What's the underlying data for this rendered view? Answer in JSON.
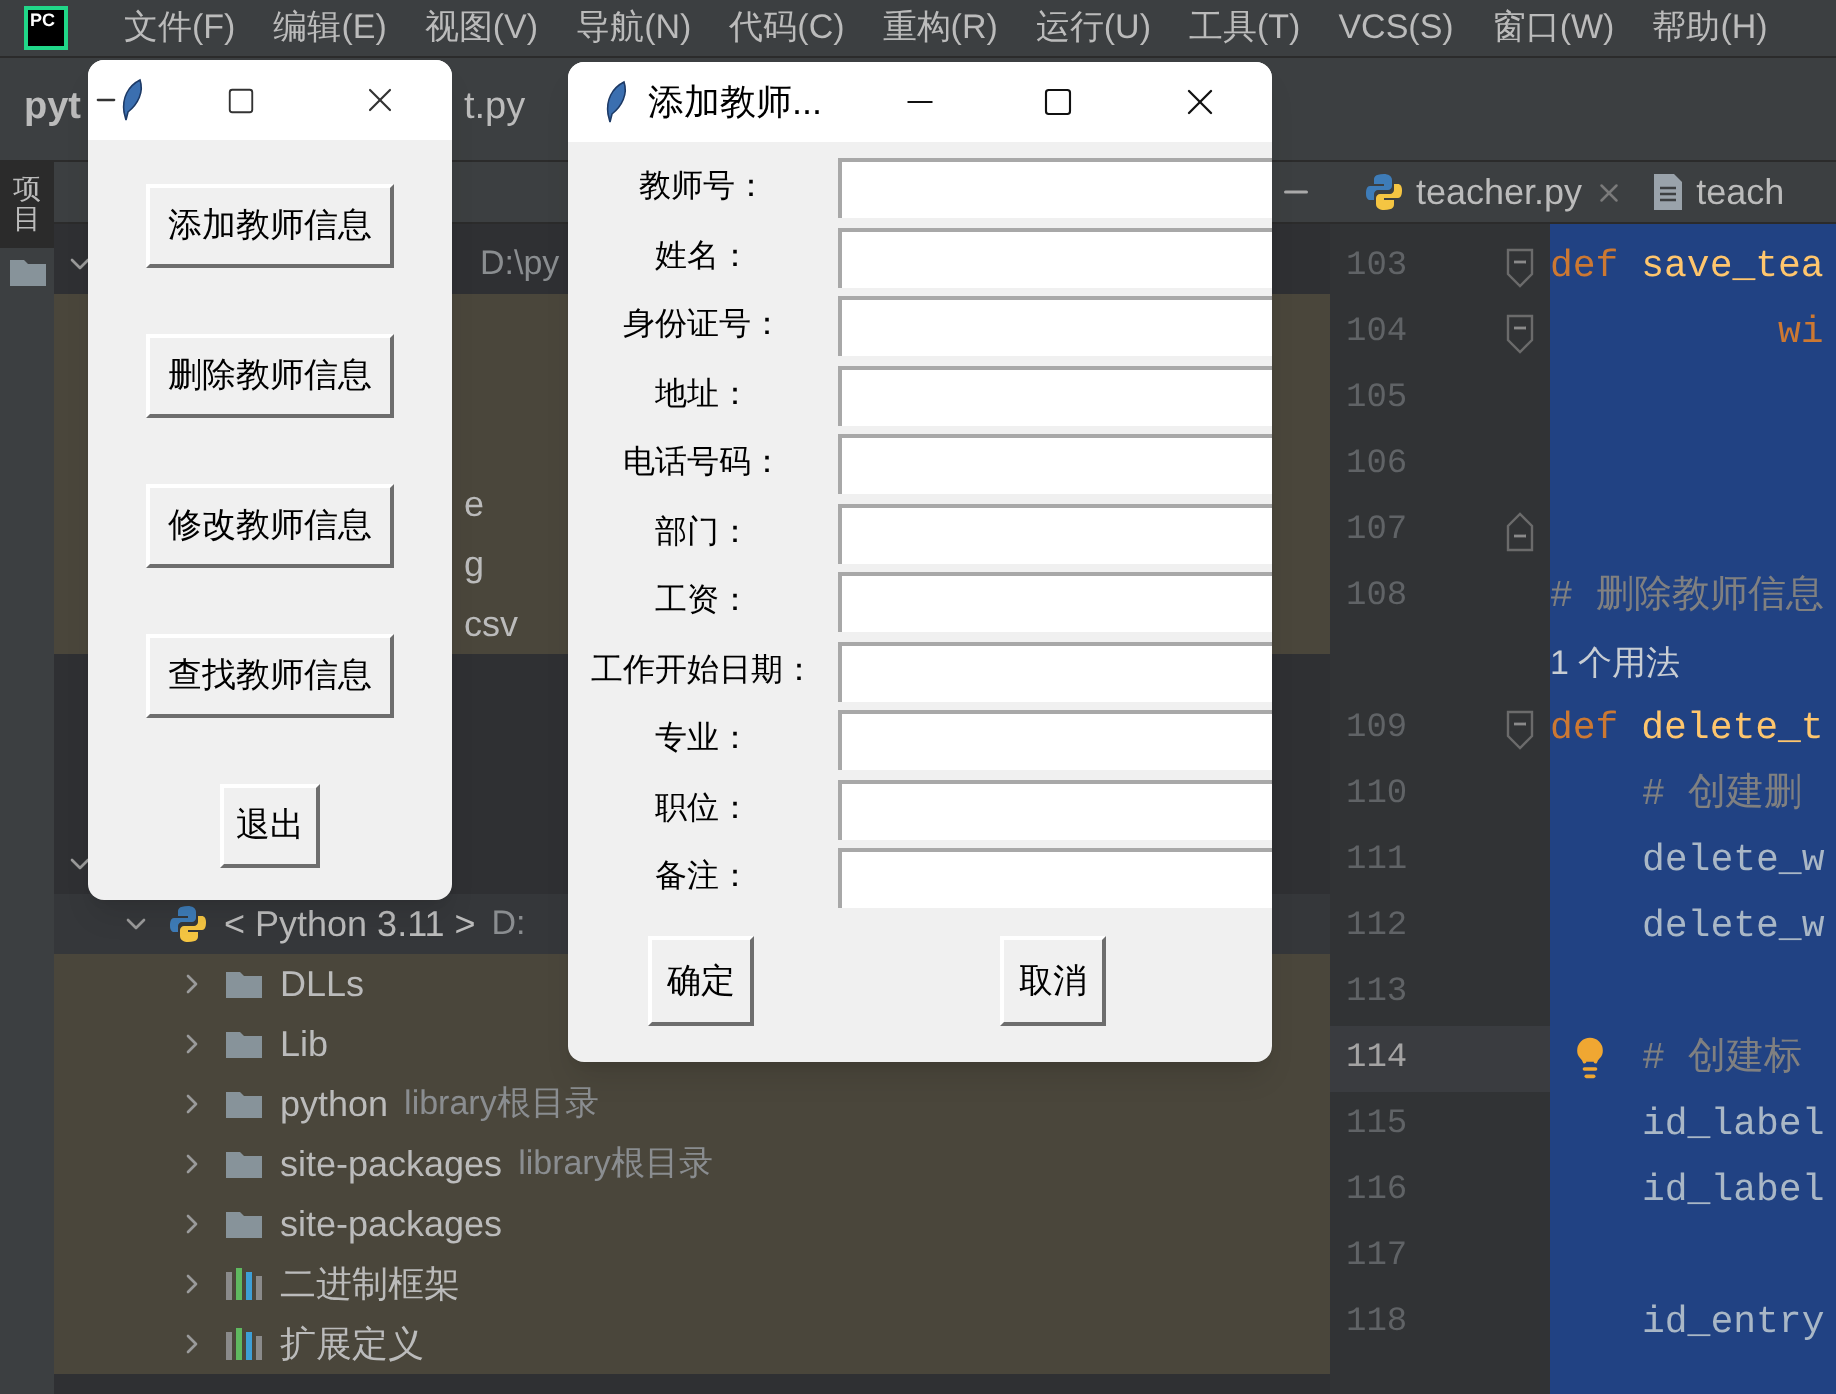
{
  "menu_bar": {
    "logo_text": "PC",
    "items": [
      "文件(F)",
      "编辑(E)",
      "视图(V)",
      "导航(N)",
      "代码(C)",
      "重构(R)",
      "运行(U)",
      "工具(T)",
      "VCS(S)",
      "窗口(W)",
      "帮助(H)"
    ]
  },
  "nav_bar": {
    "project_name": "pyt",
    "file_fragment": "t.py"
  },
  "tool_stripe": [
    {
      "label": "项目",
      "selected": true
    }
  ],
  "project_tree": [
    {
      "kind": "clipped",
      "hint": "D:\\py",
      "expanded": true,
      "children": [
        {
          "kind": "clipped",
          "label": "e"
        },
        {
          "kind": "clipped",
          "label": "g"
        },
        {
          "kind": "clipped",
          "label": "csv"
        }
      ]
    },
    {
      "kind": "clipped",
      "expanded": true,
      "children": [
        {
          "kind": "python",
          "label": "< Python 3.11 >",
          "hint": "D:",
          "expanded": true,
          "children": [
            {
              "kind": "folder",
              "label": "DLLs",
              "expanded": false
            },
            {
              "kind": "folder",
              "label": "Lib",
              "expanded": false
            },
            {
              "kind": "folder",
              "label": "python",
              "hint": "library根目录",
              "expanded": false
            },
            {
              "kind": "folder",
              "label": "site-packages",
              "hint": "library根目录",
              "expanded": false
            },
            {
              "kind": "folder",
              "label": "site-packages",
              "expanded": false
            },
            {
              "kind": "library",
              "label": "二进制框架",
              "expanded": false
            },
            {
              "kind": "library",
              "label": "扩展定义",
              "expanded": false
            }
          ]
        }
      ]
    }
  ],
  "editor": {
    "tabs": [
      {
        "label": "teacher.py",
        "kind": "python",
        "closable": true,
        "selected": false
      },
      {
        "label": "teach",
        "kind": "text",
        "closable": false,
        "selected": false
      }
    ],
    "lines": [
      {
        "number": "103",
        "fold_start": true,
        "tokens": [
          {
            "text": "def ",
            "kind": "keyword"
          },
          {
            "text": "save_tea",
            "kind": "function"
          }
        ]
      },
      {
        "number": "104",
        "fold_start": true,
        "continued": true,
        "tokens": [
          {
            "text": "wi",
            "kind": "keyword"
          }
        ]
      },
      {
        "number": "105"
      },
      {
        "number": "106"
      },
      {
        "number": "107",
        "fold_end": true
      },
      {
        "number": "108",
        "tokens": [
          {
            "text": "# 删除教师信息",
            "kind": "comment"
          }
        ]
      },
      {
        "kind": "inlay",
        "text": "1 个用法"
      },
      {
        "number": "109",
        "fold_start": true,
        "tokens": [
          {
            "text": "def ",
            "kind": "keyword"
          },
          {
            "text": "delete_t",
            "kind": "function"
          }
        ]
      },
      {
        "number": "110",
        "indented": true,
        "tokens": [
          {
            "text": "# 创建删",
            "kind": "comment"
          }
        ]
      },
      {
        "number": "111",
        "indented": true,
        "tokens": [
          {
            "text": "delete_w",
            "kind": "plain"
          }
        ]
      },
      {
        "number": "112",
        "indented": true,
        "tokens": [
          {
            "text": "delete_w",
            "kind": "plain"
          }
        ]
      },
      {
        "number": "113"
      },
      {
        "number": "114",
        "current": true,
        "bulb": true,
        "indented": true,
        "tokens": [
          {
            "text": "# 创建标",
            "kind": "comment"
          }
        ]
      },
      {
        "number": "115",
        "indented": true,
        "tokens": [
          {
            "text": "id_label",
            "kind": "plain"
          }
        ]
      },
      {
        "number": "116",
        "indented": true,
        "tokens": [
          {
            "text": "id_label",
            "kind": "plain"
          }
        ]
      },
      {
        "number": "117"
      },
      {
        "number": "118",
        "indented": true,
        "tokens": [
          {
            "text": "id_entry",
            "kind": "plain"
          }
        ]
      }
    ]
  },
  "menu_window": {
    "buttons": [
      "添加教师信息",
      "删除教师信息",
      "修改教师信息",
      "查找教师信息",
      "退出"
    ]
  },
  "add_window": {
    "title": "添加教师...",
    "fields": [
      {
        "label": "教师号："
      },
      {
        "label": "姓名："
      },
      {
        "label": "身份证号："
      },
      {
        "label": "地址："
      },
      {
        "label": "电话号码："
      },
      {
        "label": "部门："
      },
      {
        "label": "工资："
      },
      {
        "label": "工作开始日期："
      },
      {
        "label": "专业："
      },
      {
        "label": "职位："
      },
      {
        "label": "备注："
      }
    ],
    "buttons": [
      "确定",
      "取消"
    ]
  }
}
